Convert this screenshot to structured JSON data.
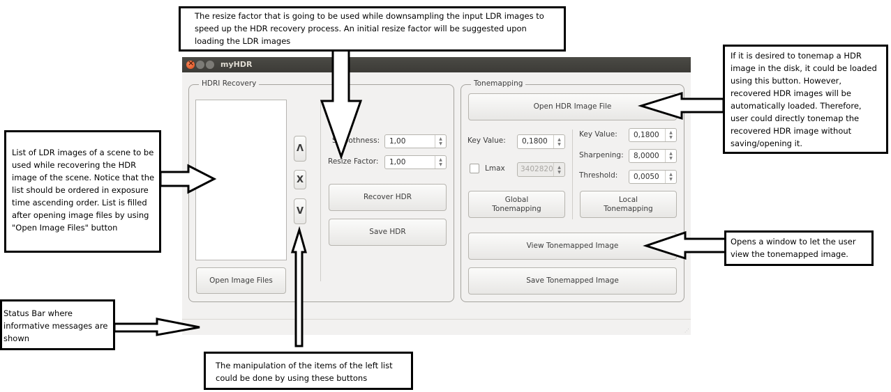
{
  "window": {
    "title": "myHDR",
    "titlebar_buttons": [
      "close",
      "minimize",
      "maximize"
    ]
  },
  "hdri_recovery": {
    "group_title": "HDRI Recovery",
    "image_list": [],
    "move_up_label": "Λ",
    "remove_label": "X",
    "move_down_label": "V",
    "open_image_files_label": "Open Image Files",
    "smoothness_label": "Smoothness:",
    "smoothness_value": "1,00",
    "resize_factor_label": "Resize Factor:",
    "resize_factor_value": "1,00",
    "recover_hdr_label": "Recover HDR",
    "save_hdr_label": "Save HDR"
  },
  "tonemapping": {
    "group_title": "Tonemapping",
    "open_hdr_label": "Open HDR Image File",
    "global": {
      "key_value_label": "Key Value:",
      "key_value": "0,1800",
      "lmax_label": "Lmax",
      "lmax_checked": false,
      "lmax_value": "3402820",
      "button_label_line1": "Global",
      "button_label_line2": "Tonemapping"
    },
    "local": {
      "key_value_label": "Key Value:",
      "key_value": "0,1800",
      "sharpening_label": "Sharpening:",
      "sharpening_value": "8,0000",
      "threshold_label": "Threshold:",
      "threshold_value": "0,0050",
      "button_label_line1": "Local",
      "button_label_line2": "Tonemapping"
    },
    "view_label": "View Tonemapped Image",
    "save_label": "Save Tonemapped Image"
  },
  "statusbar": {
    "message": ""
  },
  "annotations": {
    "resize_factor": "The resize factor that is going to be used while downsampling the input LDR images to speed up the HDR recovery process. An initial resize factor will be suggested upon loading the LDR images",
    "image_list": "List of LDR images of a scene to be used while recovering the HDR image of the scene. Notice that the list should be ordered in exposure time ascending order. List is filled after opening image files by using \"Open Image Files\" button",
    "status_bar": "Status Bar where informative messages are shown",
    "list_buttons": "The manipulation of the items of the left list could be done by using these buttons",
    "open_hdr": "If it is desired to tonemap a HDR image in the disk, it could be loaded using this button. However, recovered HDR images will be automatically loaded. Therefore, user could directly tonemap the recovered HDR image without saving/opening it.",
    "view_tonemapped": "Opens a window to let the user view the tonemapped image."
  }
}
